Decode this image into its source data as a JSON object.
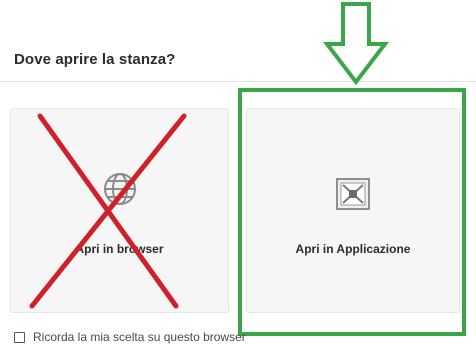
{
  "dialog": {
    "title": "Dove aprire la stanza?"
  },
  "options": [
    {
      "label": "Apri in browser",
      "icon": "globe-icon"
    },
    {
      "label": "Apri in Applicazione",
      "icon": "application-icon"
    }
  ],
  "remember": {
    "label": "Ricorda la mia scelta su questo browser",
    "checked": false
  },
  "annotations": {
    "highlight_color": "#3ba54a",
    "cross_color": "#d0202a"
  }
}
